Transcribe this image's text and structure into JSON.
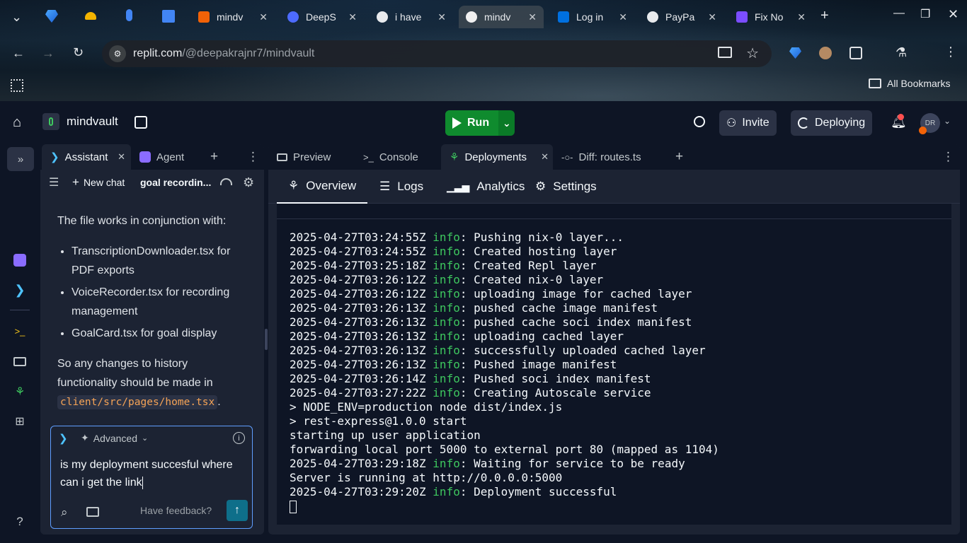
{
  "browser": {
    "tabs": [
      {
        "title": "mindv",
        "active": false
      },
      {
        "title": "DeepS",
        "active": false
      },
      {
        "title": "i have",
        "active": false
      },
      {
        "title": "mindv",
        "active": true
      },
      {
        "title": "Log in",
        "active": false
      },
      {
        "title": "PayPa",
        "active": false
      },
      {
        "title": "Fix No",
        "active": false
      }
    ],
    "url_host": "replit.com",
    "url_path": "/@deepakrajnr7/mindvault",
    "bookmarks_label": "All Bookmarks"
  },
  "replit_top": {
    "project_name": "mindvault",
    "run_label": "Run",
    "invite_label": "Invite",
    "deploying_label": "Deploying",
    "avatar_initials": "DR"
  },
  "left_panel": {
    "tabs": [
      {
        "label": "Assistant"
      },
      {
        "label": "Agent"
      }
    ],
    "new_chat_label": "New chat",
    "chat_title": "goal recordin...",
    "message": {
      "intro": "The file works in conjunction with:",
      "items": [
        "TranscriptionDownloader.tsx for PDF exports",
        "VoiceRecorder.tsx for recording management",
        "GoalCard.tsx for goal display"
      ],
      "outro": "So any changes to history functionality should be made in",
      "code": "client/src/pages/home.tsx",
      "outro_end": "."
    },
    "composer": {
      "mode_label": "Advanced",
      "input_value": "is my deployment succesful where can i get the link",
      "feedback_label": "Have feedback?"
    }
  },
  "right_panel": {
    "tabs": [
      {
        "label": "Preview"
      },
      {
        "label": "Console"
      },
      {
        "label": "Deployments"
      },
      {
        "label": "Diff: routes.ts"
      }
    ],
    "subtabs": [
      {
        "label": "Overview"
      },
      {
        "label": "Logs"
      },
      {
        "label": "Analytics"
      },
      {
        "label": "Settings"
      }
    ],
    "log_lines": [
      {
        "ts": "2025-04-27T03:24:55Z",
        "level": "info",
        "msg": ": Pushing nix-0 layer..."
      },
      {
        "ts": "2025-04-27T03:24:55Z",
        "level": "info",
        "msg": ": Created hosting layer"
      },
      {
        "ts": "2025-04-27T03:25:18Z",
        "level": "info",
        "msg": ": Created Repl layer"
      },
      {
        "ts": "2025-04-27T03:26:12Z",
        "level": "info",
        "msg": ": Created nix-0 layer"
      },
      {
        "ts": "2025-04-27T03:26:12Z",
        "level": "info",
        "msg": ": uploading image for cached layer"
      },
      {
        "ts": "2025-04-27T03:26:13Z",
        "level": "info",
        "msg": ": pushed cache image manifest"
      },
      {
        "ts": "2025-04-27T03:26:13Z",
        "level": "info",
        "msg": ": pushed cache soci index manifest"
      },
      {
        "ts": "2025-04-27T03:26:13Z",
        "level": "info",
        "msg": ": uploading cached layer"
      },
      {
        "ts": "2025-04-27T03:26:13Z",
        "level": "info",
        "msg": ": successfully uploaded cached layer"
      },
      {
        "ts": "2025-04-27T03:26:13Z",
        "level": "info",
        "msg": ": Pushed image manifest"
      },
      {
        "ts": "2025-04-27T03:26:14Z",
        "level": "info",
        "msg": ": Pushed soci index manifest"
      },
      {
        "ts": "2025-04-27T03:27:22Z",
        "level": "info",
        "msg": ": Creating Autoscale service"
      },
      {
        "ts": "",
        "level": "",
        "msg": "> NODE_ENV=production node dist/index.js"
      },
      {
        "ts": "",
        "level": "",
        "msg": "> rest-express@1.0.0 start"
      },
      {
        "ts": "",
        "level": "",
        "msg": "starting up user application"
      },
      {
        "ts": "",
        "level": "",
        "msg": "forwarding local port 5000 to external port 80 (mapped as 1104)"
      },
      {
        "ts": "2025-04-27T03:29:18Z",
        "level": "info",
        "msg": ": Waiting for service to be ready"
      },
      {
        "ts": "",
        "level": "",
        "msg": "Server is running at http://0.0.0.0:5000"
      },
      {
        "ts": "2025-04-27T03:29:20Z",
        "level": "info",
        "msg": ": Deployment successful"
      }
    ]
  },
  "colors": {
    "run_green": "#0f8b2e",
    "log_info_green": "#3ec85f",
    "code_orange": "#f5a356",
    "focus_blue": "#5f9eff",
    "panel_bg": "#1c2333",
    "app_bg": "#0e1525"
  }
}
